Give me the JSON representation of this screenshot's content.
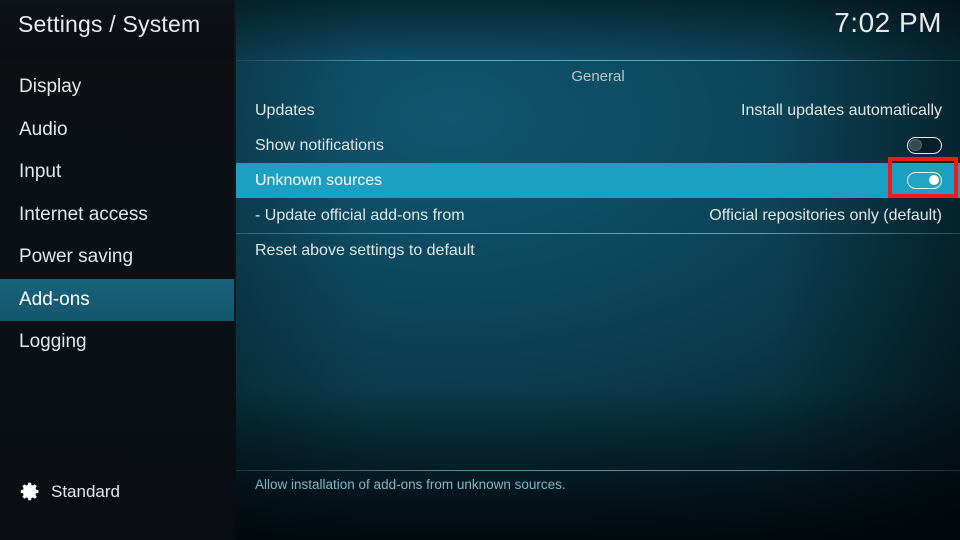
{
  "header": {
    "title": "Settings / System",
    "clock": "7:02 PM"
  },
  "sidebar": {
    "items": [
      {
        "label": "Display",
        "selected": false
      },
      {
        "label": "Audio",
        "selected": false
      },
      {
        "label": "Input",
        "selected": false
      },
      {
        "label": "Internet access",
        "selected": false
      },
      {
        "label": "Power saving",
        "selected": false
      },
      {
        "label": "Add-ons",
        "selected": true
      },
      {
        "label": "Logging",
        "selected": false
      }
    ],
    "profile": {
      "icon": "gear-icon",
      "label": "Standard"
    }
  },
  "content": {
    "group_header": "General",
    "rows": [
      {
        "label": "Updates",
        "control": "value",
        "value": "Install updates automatically",
        "selected": false,
        "separator_above": false
      },
      {
        "label": "Show notifications",
        "control": "toggle",
        "toggle_state": "off",
        "selected": false,
        "separator_above": false
      },
      {
        "label": "Unknown sources",
        "control": "toggle",
        "toggle_state": "on",
        "selected": true,
        "separator_above": false
      },
      {
        "label": "- Update official add-ons from",
        "control": "value",
        "value": "Official repositories only (default)",
        "selected": false,
        "separator_above": false
      },
      {
        "label": "Reset above settings to default",
        "control": "none",
        "selected": false,
        "separator_above": true
      }
    ],
    "description": "Allow installation of add-ons from unknown sources."
  },
  "annotation": {
    "target": "unknown-sources-toggle",
    "color": "#ee1b1b"
  },
  "colors": {
    "selected_row": "#1ba0c4",
    "sidebar_selected": "#17637b",
    "description_text": "#7fb8c9",
    "annotation_red": "#ee1b1b"
  }
}
